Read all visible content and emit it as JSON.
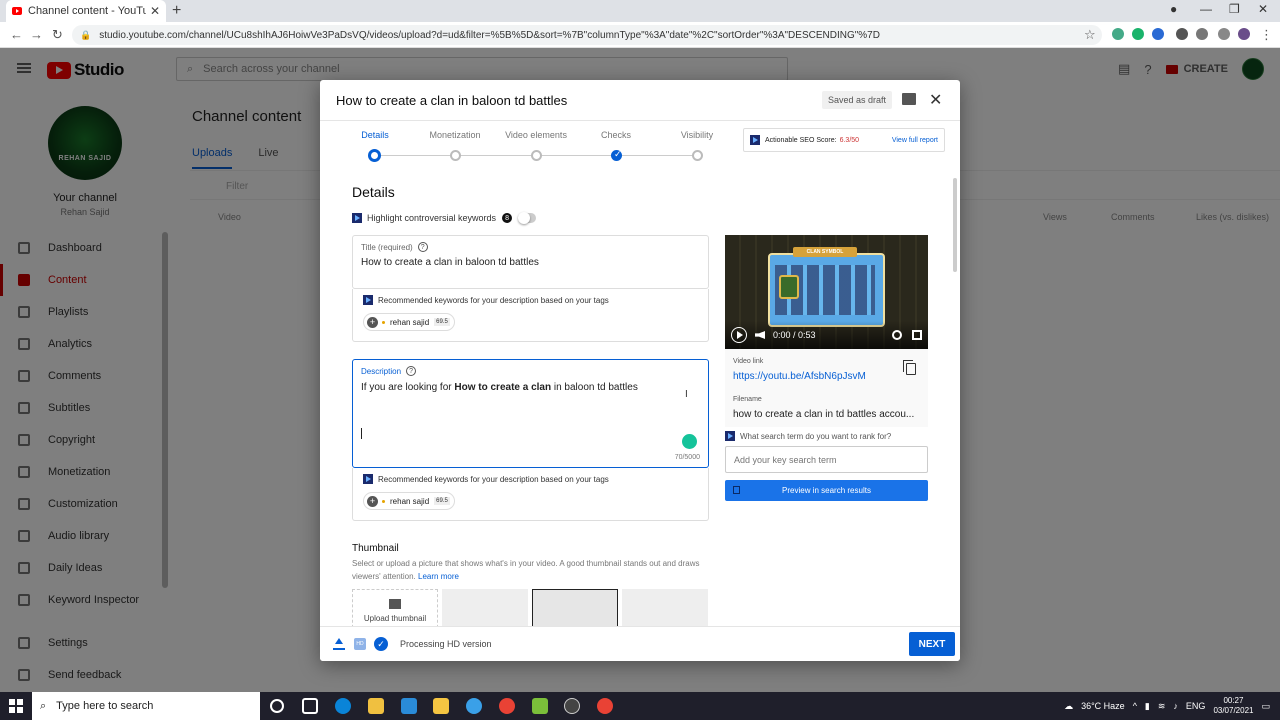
{
  "browser": {
    "tab_title": "Channel content - YouTube Studio",
    "url": "studio.youtube.com/channel/UCu8shIhAJ6HoiwVe3PaDsVQ/videos/upload?d=ud&filter=%5B%5D&sort=%7B\"columnType\"%3A\"date\"%2C\"sortOrder\"%3A\"DESCENDING\"%7D"
  },
  "studio": {
    "logo_text": "Studio",
    "search_placeholder": "Search across your channel",
    "create_label": "CREATE",
    "channel_avatar_text": "REHAN SAJID",
    "your_channel": "Your channel",
    "channel_name": "Rehan Sajid",
    "nav": [
      {
        "label": "Dashboard",
        "active": false
      },
      {
        "label": "Content",
        "active": true
      },
      {
        "label": "Playlists",
        "active": false
      },
      {
        "label": "Analytics",
        "active": false
      },
      {
        "label": "Comments",
        "active": false
      },
      {
        "label": "Subtitles",
        "active": false
      },
      {
        "label": "Copyright",
        "active": false
      },
      {
        "label": "Monetization",
        "active": false
      },
      {
        "label": "Customization",
        "active": false
      },
      {
        "label": "Audio library",
        "active": false
      },
      {
        "label": "Daily Ideas",
        "active": false
      },
      {
        "label": "Keyword Inspector",
        "active": false
      }
    ],
    "nav_settings": "Settings",
    "nav_feedback": "Send feedback",
    "page_title": "Channel content",
    "tabs": [
      "Uploads",
      "Live"
    ],
    "filter": "Filter",
    "col_video": "Video",
    "col_views": "Views",
    "col_comments": "Comments",
    "col_likes": "Likes (vs. dislikes)"
  },
  "dialog": {
    "title": "How to create a clan in baloon td battles",
    "saved_label": "Saved as draft",
    "steps": [
      {
        "label": "Details",
        "state": "current"
      },
      {
        "label": "Monetization",
        "state": "todo"
      },
      {
        "label": "Video elements",
        "state": "todo"
      },
      {
        "label": "Checks",
        "state": "done"
      },
      {
        "label": "Visibility",
        "state": "todo"
      }
    ],
    "seo_label": "Actionable SEO Score:",
    "seo_score": "6.3/50",
    "seo_link": "View full report",
    "section_title": "Details",
    "highlight_label": "Highlight controversial keywords",
    "highlight_badge": "8",
    "title_label": "Title (required)",
    "title_value": "How to create a clan in  baloon td battles",
    "rec_label": "Recommended keywords for your description based on your tags",
    "chip_label": "rehan sajid",
    "chip_score": "69.5",
    "desc_label": "Description",
    "desc_prefix": "If you are looking for ",
    "desc_bold": "How to create a clan",
    "desc_suffix": " in  baloon td battles",
    "desc_count": "70/5000",
    "rec2_label": "Recommended keywords for your description based on your tags",
    "chip2_label": "rehan sajid",
    "chip2_score": "69.5",
    "thumb_title": "Thumbnail",
    "thumb_desc": "Select or upload a picture that shows what's in your video. A good thumbnail stands out and draws viewers' attention.",
    "thumb_learn": "Learn more",
    "upload_thumb": "Upload thumbnail",
    "video_time": "0:00 / 0:53",
    "video_banner": "CLAN SYMBOL",
    "video_link_label": "Video link",
    "video_link": "https://youtu.be/AfsbN6pJsvM",
    "filename_label": "Filename",
    "filename": "how to create a clan in td battles accou...",
    "rank_question": "What search term do you want to rank for?",
    "key_placeholder": "Add your key search term",
    "preview_btn": "Preview in search results",
    "processing": "Processing HD version",
    "next": "NEXT",
    "hd_badge": "HD"
  },
  "taskbar": {
    "search": "Type here to search",
    "weather": "36°C  Haze",
    "lang": "ENG",
    "time": "00:27",
    "date": "03/07/2021"
  },
  "colors": {
    "accent": "#065fd4",
    "brand_red": "#ff0000",
    "preview_btn": "#1a73e8"
  }
}
